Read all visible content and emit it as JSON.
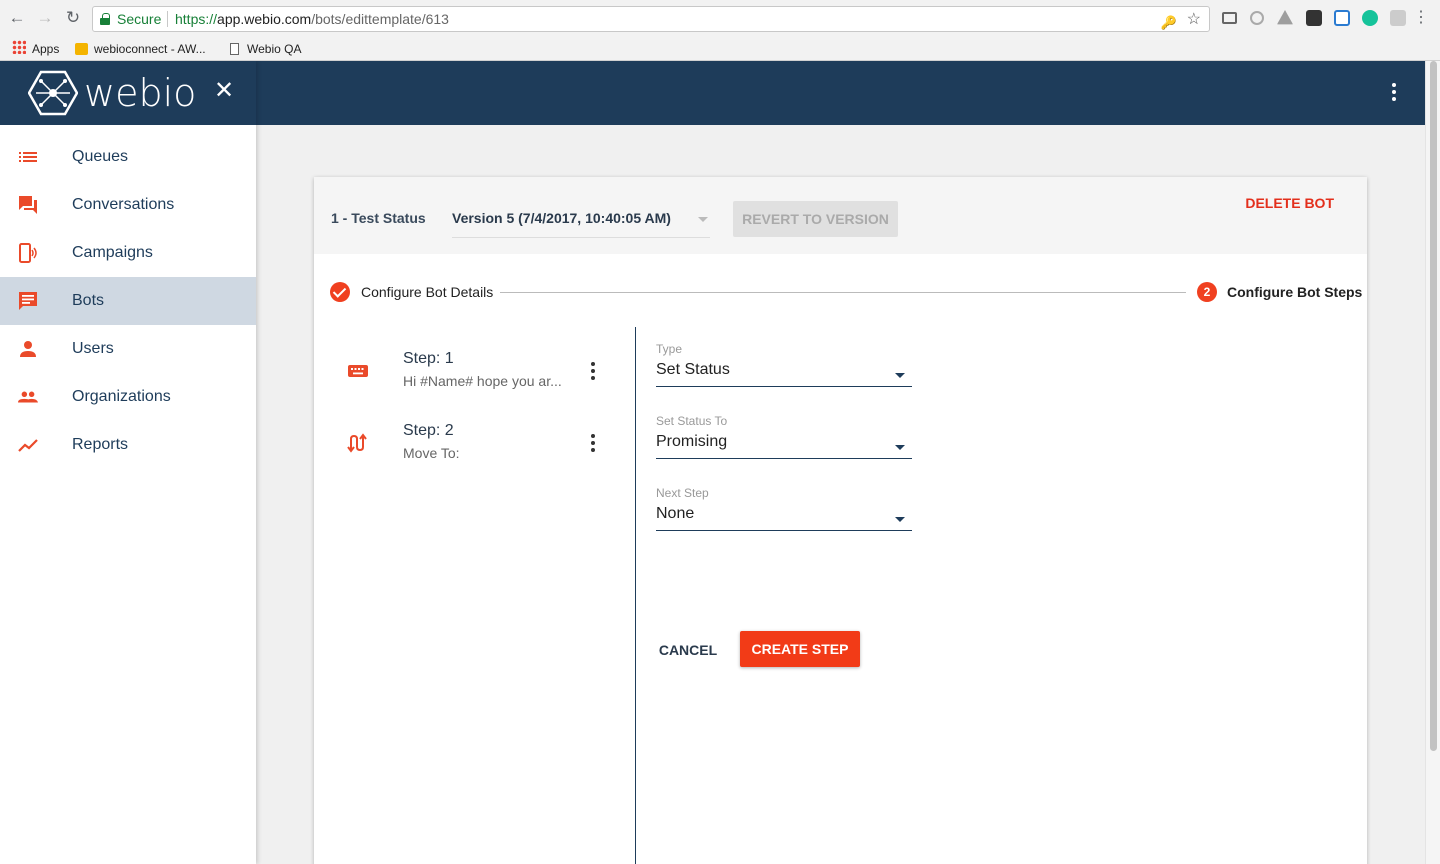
{
  "browser": {
    "secure_label": "Secure",
    "url_scheme": "https://",
    "url_host": "app.webio.com",
    "url_path": "/bots/edittemplate/613",
    "bookmarks": [
      {
        "label": "Apps"
      },
      {
        "label": "webioconnect - AW..."
      },
      {
        "label": "Webio QA"
      }
    ]
  },
  "sidebar": {
    "logo_text": "webio",
    "items": [
      {
        "label": "Queues",
        "icon": "list-icon"
      },
      {
        "label": "Conversations",
        "icon": "chat-icon"
      },
      {
        "label": "Campaigns",
        "icon": "phone-broadcast-icon"
      },
      {
        "label": "Bots",
        "icon": "message-icon"
      },
      {
        "label": "Users",
        "icon": "person-icon"
      },
      {
        "label": "Organizations",
        "icon": "people-icon"
      },
      {
        "label": "Reports",
        "icon": "trending-icon"
      }
    ],
    "active_item": "Bots"
  },
  "header": {
    "bot_name": "1 - Test Status",
    "version": "Version 5 (7/4/2017, 10:40:05 AM)",
    "revert_label": "REVERT TO VERSION",
    "delete_label": "DELETE BOT"
  },
  "stepper": {
    "step1": "Configure Bot Details",
    "step2_number": "2",
    "step2": "Configure Bot Steps"
  },
  "steps": [
    {
      "title": "Step: 1",
      "subtitle": "Hi #Name# hope you ar...",
      "icon": "keyboard-icon"
    },
    {
      "title": "Step: 2",
      "subtitle": "Move To:",
      "icon": "swap-icon"
    }
  ],
  "form": {
    "type_label": "Type",
    "type_value": "Set Status",
    "status_label": "Set Status To",
    "status_value": "Promising",
    "next_label": "Next Step",
    "next_value": "None",
    "cancel_label": "CANCEL",
    "create_label": "CREATE STEP"
  },
  "colors": {
    "navy": "#1e3c5a",
    "accent": "#f23b17",
    "active_bg": "#cfd8e2"
  }
}
